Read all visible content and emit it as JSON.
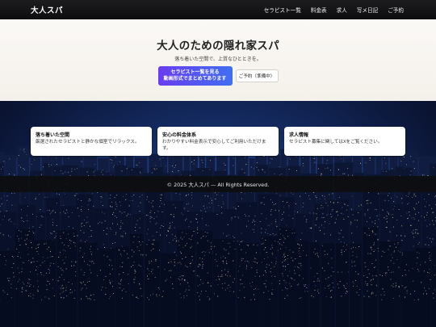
{
  "header": {
    "brand": "大人スパ",
    "nav": [
      {
        "label": "セラピスト一覧"
      },
      {
        "label": "料金表"
      },
      {
        "label": "求人"
      },
      {
        "label": "写メ日記"
      },
      {
        "label": "ご予約"
      }
    ]
  },
  "hero": {
    "title": "大人のための隠れ家スパ",
    "subtitle": "落ち着いた空間で、上質なひとときを。",
    "primary_button": {
      "line1": "セラピスト一覧を見る",
      "line2": "動画形式でまとめてあります"
    },
    "secondary_button": "ご予約（準備中）"
  },
  "features": [
    {
      "title": "落ち着いた空間",
      "text": "厳選されたセラピストと静かな個室でリラックス。"
    },
    {
      "title": "安心の料金体系",
      "text": "わかりやすい料金表示で安心してご利用いただけます。"
    },
    {
      "title": "求人情報",
      "text": "セラピスト募集に関してはXをご覧ください。"
    }
  ],
  "footer": {
    "copyright": "© 2025 大人スパ — All Rights Reserved."
  },
  "colors": {
    "header_bg": "#151517",
    "hero_bg": "#f7f4ef",
    "primary_gradient_start": "#6a3cf0",
    "primary_gradient_end": "#3f6ff1",
    "city_sky": "#142b62"
  }
}
